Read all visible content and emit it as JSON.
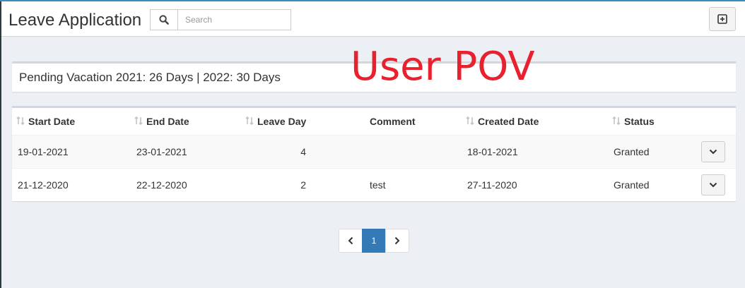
{
  "header": {
    "title": "Leave Application",
    "search": {
      "placeholder": "Search",
      "value": ""
    },
    "add_button_icon": "plus-square-icon"
  },
  "overlay_text": "User POV",
  "pending": {
    "text": "Pending Vacation 2021: 26 Days | 2022: 30 Days"
  },
  "table": {
    "columns": [
      {
        "label": "Start Date",
        "sortable": true
      },
      {
        "label": "End Date",
        "sortable": true
      },
      {
        "label": "Leave Day",
        "sortable": true
      },
      {
        "label": "Comment",
        "sortable": false
      },
      {
        "label": "Created Date",
        "sortable": true
      },
      {
        "label": "Status",
        "sortable": true
      }
    ],
    "rows": [
      {
        "start_date": "19-01-2021",
        "end_date": "23-01-2021",
        "leave_day": "4",
        "comment": "",
        "created_date": "18-01-2021",
        "status": "Granted"
      },
      {
        "start_date": "21-12-2020",
        "end_date": "22-12-2020",
        "leave_day": "2",
        "comment": "test",
        "created_date": "27-11-2020",
        "status": "Granted"
      }
    ]
  },
  "pagination": {
    "pages": [
      "1"
    ],
    "current": "1"
  },
  "colors": {
    "accent": "#3c8dbc",
    "overlay": "#e8212e",
    "active_page": "#337ab7"
  }
}
